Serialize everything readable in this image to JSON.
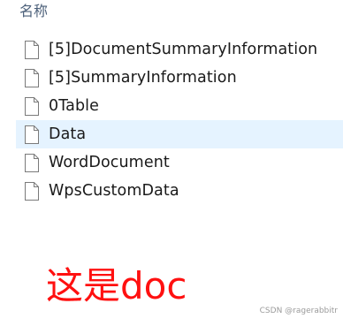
{
  "list": {
    "column_header": "名称",
    "items": [
      {
        "name": "[5]DocumentSummaryInformation",
        "icon": "file-icon",
        "selected": false
      },
      {
        "name": "[5]SummaryInformation",
        "icon": "file-icon",
        "selected": false
      },
      {
        "name": "0Table",
        "icon": "file-icon",
        "selected": false
      },
      {
        "name": "Data",
        "icon": "file-icon",
        "selected": true
      },
      {
        "name": "WordDocument",
        "icon": "file-icon",
        "selected": false
      },
      {
        "name": "WpsCustomData",
        "icon": "file-icon",
        "selected": false
      }
    ]
  },
  "annotation": {
    "text": "这是doc",
    "color": "#ff1010"
  },
  "watermark": {
    "text": "CSDN @ragerabbitr"
  },
  "colors": {
    "selected_row": "#e5f3ff",
    "header_text": "#4c607a"
  }
}
